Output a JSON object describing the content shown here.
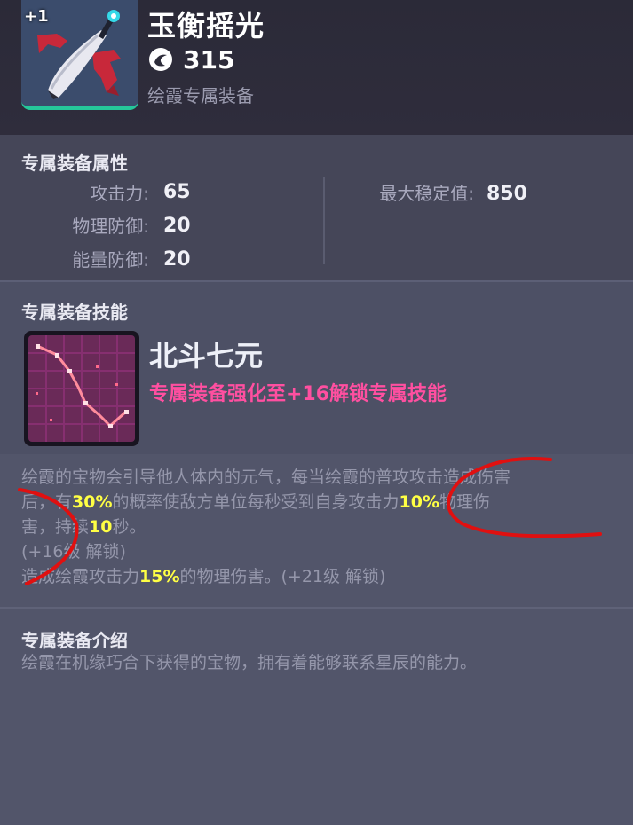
{
  "item": {
    "plus": "+1",
    "name": "玉衡摇光",
    "power": "315",
    "subtitle": "绘霞专属装备"
  },
  "attributes": {
    "title": "专属装备属性",
    "left": [
      {
        "label": "攻击力:",
        "value": "65"
      },
      {
        "label": "物理防御:",
        "value": "20"
      },
      {
        "label": "能量防御:",
        "value": "20"
      }
    ],
    "right": [
      {
        "label": "最大稳定值:",
        "value": "850"
      }
    ]
  },
  "skill": {
    "title": "专属装备技能",
    "name": "北斗七元",
    "unlock": "专属装备强化至+16解锁专属技能",
    "desc": {
      "l1": "绘霞的宝物会引导他人体内的元气，每当绘霞的普攻攻击造成伤害",
      "l2a": "后，有",
      "l2b": "30%",
      "l2c": "的概率使敌方单位每秒受到自身攻击力",
      "l2d": "10%",
      "l2e": "物理伤",
      "l3a": "害，持续",
      "l3b": "10",
      "l3c": "秒。",
      "l4": "(+16级 解锁)",
      "l5a": "造成绘霞攻击力",
      "l5b": "15%",
      "l5c": "的物理伤害。(+21级 解锁)"
    }
  },
  "intro": {
    "title": "专属装备介绍",
    "text": "绘霞在机缘巧合下获得的宝物，拥有着能够联系星辰的能力。"
  },
  "colors": {
    "highlight": "#ffff44",
    "unlock": "#ff4fa0",
    "annotation": "#e01010",
    "rarity_bar": "#25c79a"
  },
  "icons": {
    "power": "power-swirl-icon",
    "item": "fan-ribbon-icon",
    "skill": "constellation-icon"
  }
}
